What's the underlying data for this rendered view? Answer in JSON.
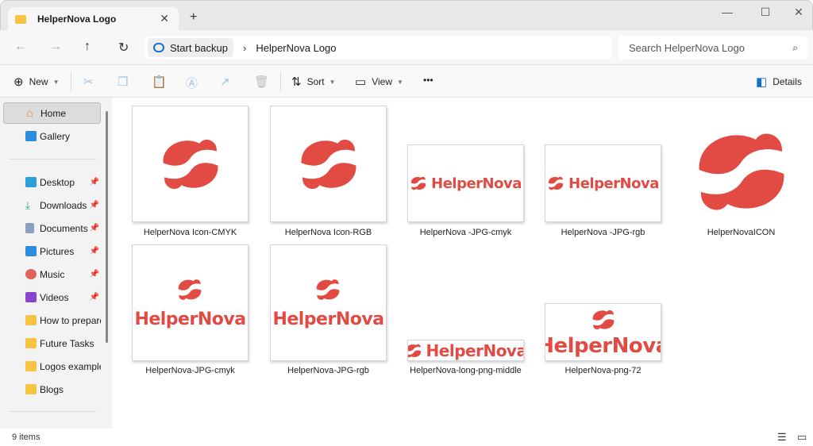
{
  "window": {
    "tab_title": "HelperNova Logo",
    "new_tab": "+",
    "close_tab": "✕"
  },
  "address": {
    "backup": "Start backup",
    "current": "HelperNova Logo",
    "search_placeholder": "Search HelperNova Logo"
  },
  "toolbar": {
    "new": "New",
    "sort": "Sort",
    "view": "View",
    "more": "•••",
    "details": "Details"
  },
  "sidebar": {
    "top": [
      {
        "label": "Home"
      },
      {
        "label": "Gallery"
      }
    ],
    "pinned": [
      {
        "label": "Desktop"
      },
      {
        "label": "Downloads"
      },
      {
        "label": "Documents"
      },
      {
        "label": "Pictures"
      },
      {
        "label": "Music"
      },
      {
        "label": "Videos"
      }
    ],
    "folders": [
      {
        "label": "How to prepare"
      },
      {
        "label": "Future Tasks"
      },
      {
        "label": "Logos examples"
      },
      {
        "label": "Blogs"
      }
    ]
  },
  "brand_color": "#e14b43",
  "logo_word": "HelperNova",
  "files": [
    {
      "name": "HelperNova Icon-CMYK"
    },
    {
      "name": "HelperNova Icon-RGB"
    },
    {
      "name": "HelperNova -JPG-cmyk"
    },
    {
      "name": "HelperNova -JPG-rgb"
    },
    {
      "name": "HelperNovaICON"
    },
    {
      "name": "HelperNova-JPG-cmyk"
    },
    {
      "name": "HelperNova-JPG-rgb"
    },
    {
      "name": "HelperNova-long-png-middle"
    },
    {
      "name": "HelperNova-png-72"
    }
  ],
  "status": {
    "count": "9 items"
  }
}
